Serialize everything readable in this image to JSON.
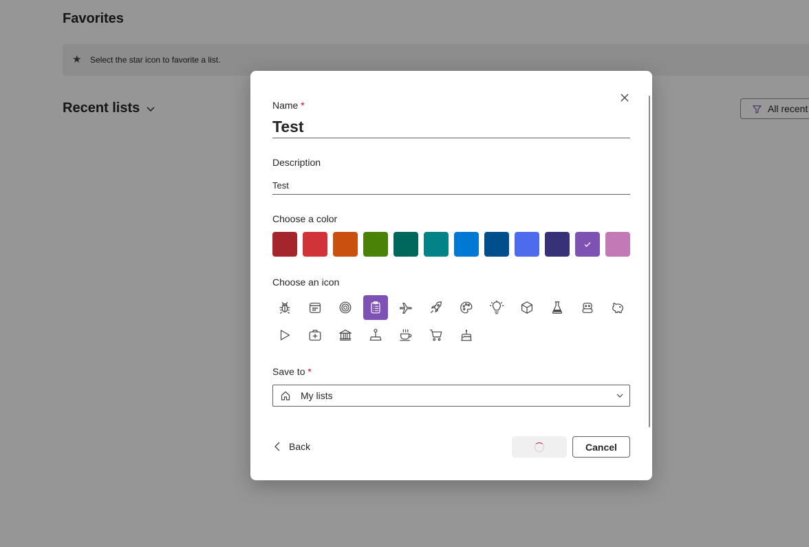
{
  "background": {
    "favorites_title": "Favorites",
    "favorites_hint": "Select the star icon to favorite a list.",
    "recent_title": "Recent lists",
    "filter_label": "All recent"
  },
  "dialog": {
    "name_label": "Name",
    "name_required": "*",
    "name_value": "Test",
    "description_label": "Description",
    "description_value": "Test",
    "color_label": "Choose a color",
    "colors": [
      "#a4262c",
      "#d13438",
      "#ca5010",
      "#498205",
      "#00675c",
      "#038387",
      "#0078d4",
      "#004e8c",
      "#4f6bed",
      "#373277",
      "#7e52b3",
      "#c27ab6"
    ],
    "selected_color_index": 10,
    "icon_label": "Choose an icon",
    "icons": [
      "bug-icon",
      "calendar-icon",
      "target-icon",
      "clipboard-icon",
      "airplane-icon",
      "rocket-icon",
      "palette-icon",
      "lightbulb-icon",
      "cube-icon",
      "beaker-icon",
      "robot-icon",
      "piggy-bank-icon",
      "play-icon",
      "medical-kit-icon",
      "bank-icon",
      "joystick-icon",
      "coffee-icon",
      "shopping-cart-icon",
      "cake-icon"
    ],
    "selected_icon_index": 3,
    "save_to_label": "Save to",
    "save_to_required": "*",
    "save_to_value": "My lists",
    "back_label": "Back",
    "cancel_label": "Cancel"
  }
}
